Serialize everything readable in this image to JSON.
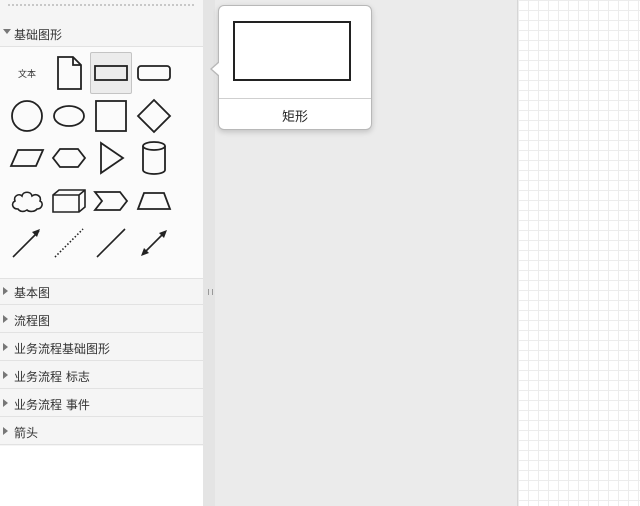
{
  "sidebar": {
    "active_section": "基础图形",
    "text_shape_label": "文本",
    "sections": [
      {
        "label": "基本图"
      },
      {
        "label": "流程图"
      },
      {
        "label": "业务流程基础图形"
      },
      {
        "label": "业务流程 标志"
      },
      {
        "label": "业务流程 事件"
      },
      {
        "label": "箭头"
      }
    ],
    "shapes": [
      {
        "name": "text-shape"
      },
      {
        "name": "document-shape"
      },
      {
        "name": "rectangle-shape"
      },
      {
        "name": "rounded-rectangle-shape"
      },
      {
        "name": "circle-shape"
      },
      {
        "name": "ellipse-shape"
      },
      {
        "name": "square-shape"
      },
      {
        "name": "diamond-shape"
      },
      {
        "name": "parallelogram-shape"
      },
      {
        "name": "hexagon-shape"
      },
      {
        "name": "triangle-shape"
      },
      {
        "name": "cylinder-shape"
      },
      {
        "name": "cloud-shape"
      },
      {
        "name": "cube-shape"
      },
      {
        "name": "step-shape"
      },
      {
        "name": "trapezoid-shape"
      },
      {
        "name": "arrow-line-shape"
      },
      {
        "name": "dotted-line-shape"
      },
      {
        "name": "line-shape"
      },
      {
        "name": "double-arrow-line-shape"
      }
    ]
  },
  "tooltip": {
    "label": "矩形"
  }
}
